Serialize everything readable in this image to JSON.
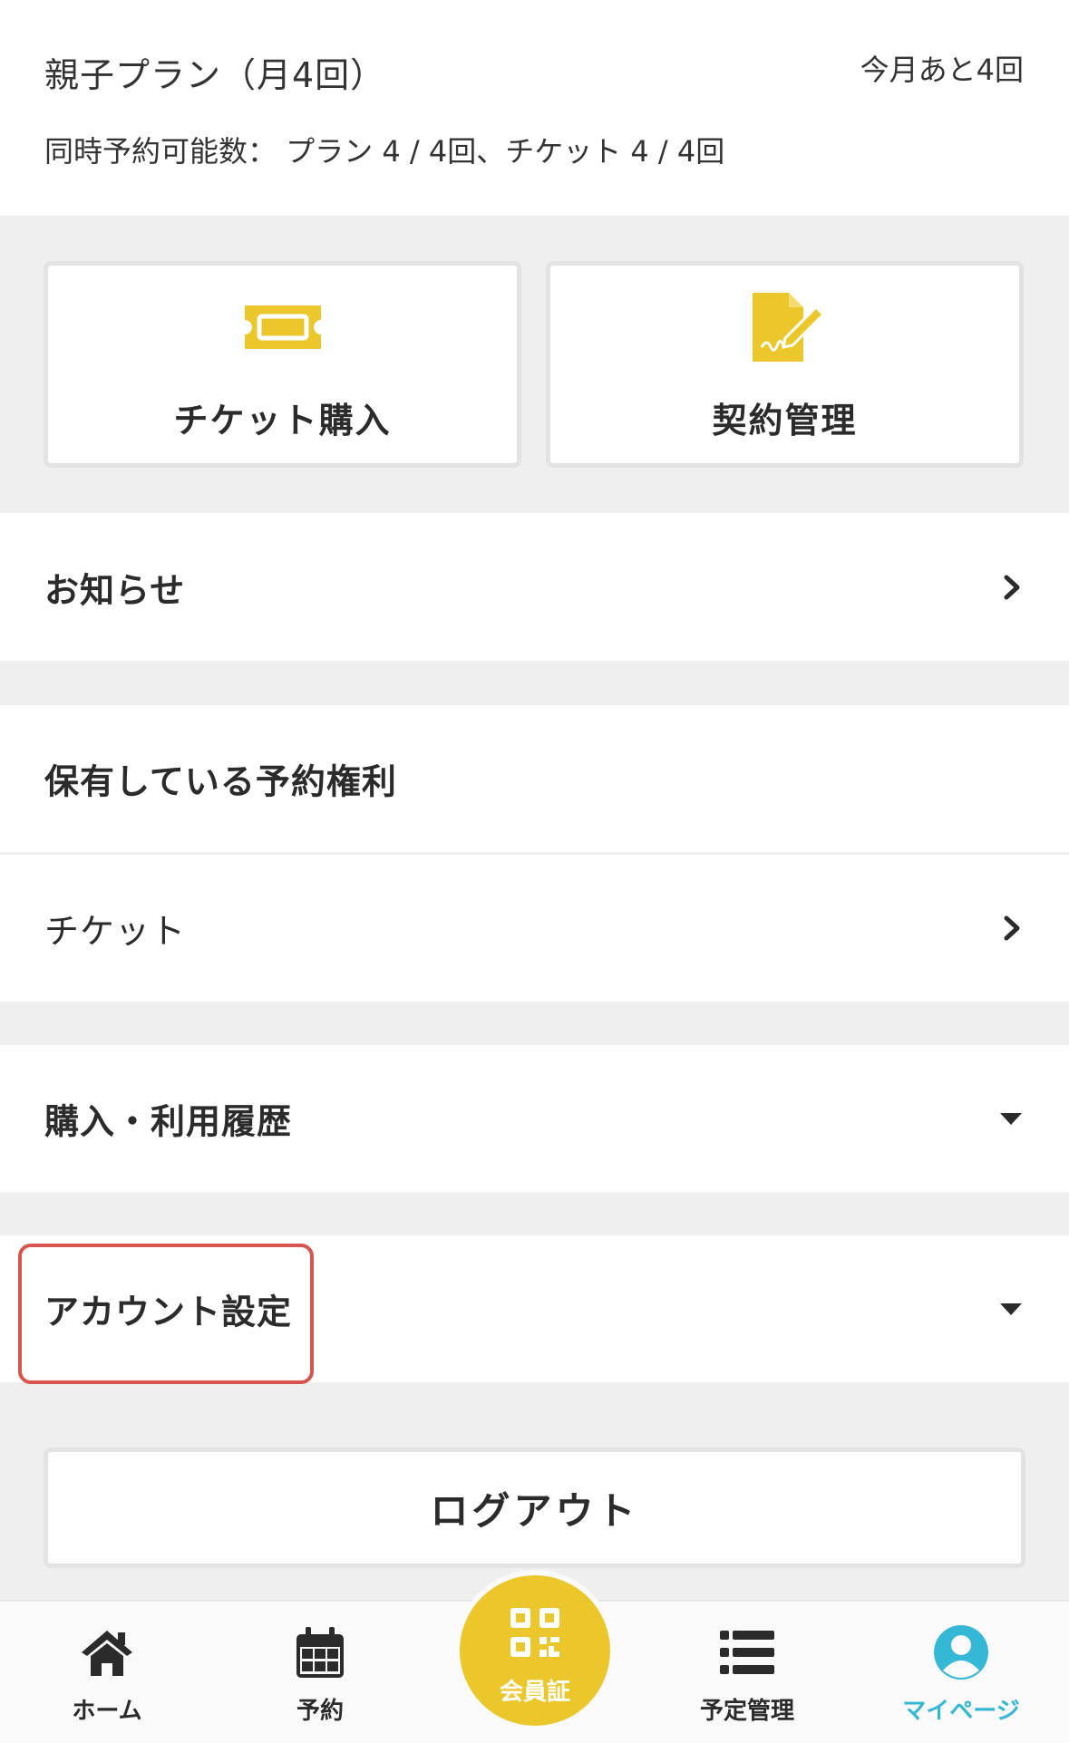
{
  "plan": {
    "title": "親子プラン（月4回）",
    "remaining": "今月あと4回",
    "concurrent": "同時予約可能数： プラン 4 / 4回、チケット 4 / 4回"
  },
  "cards": {
    "ticket_purchase": "チケット購入",
    "contract_management": "契約管理"
  },
  "rows": {
    "notices": "お知らせ",
    "held_rights": "保有している予約権利",
    "tickets": "チケット",
    "history": "購入・利用履歴",
    "account_settings": "アカウント設定"
  },
  "logout": "ログアウト",
  "nav": {
    "home": "ホーム",
    "reserve": "予約",
    "member_card": "会員証",
    "schedule": "予定管理",
    "mypage": "マイページ"
  },
  "colors": {
    "accent_yellow": "#ecc72b",
    "active_blue": "#35b7d6",
    "highlight_red": "#d9534f"
  }
}
